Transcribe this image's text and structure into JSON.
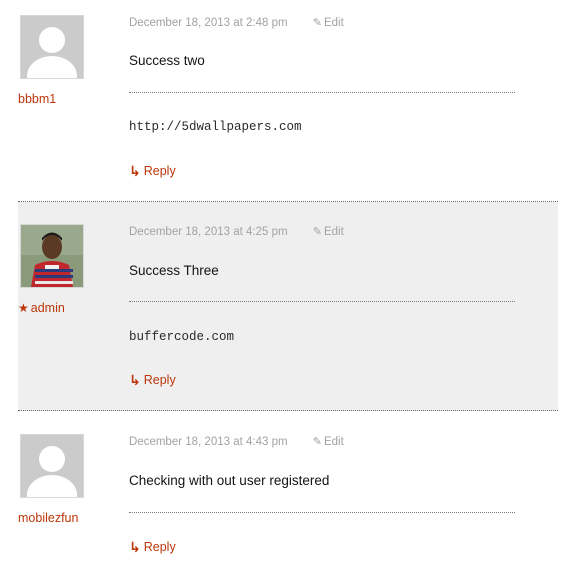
{
  "comments": [
    {
      "author": "bbbm1",
      "is_admin": false,
      "date": "December 18, 2013 at 2:48 pm",
      "edit_label": "Edit",
      "text": "Success two",
      "signature": "http://5dwallpapers.com",
      "reply_label": "Reply"
    },
    {
      "author": "admin",
      "is_admin": true,
      "date": "December 18, 2013 at 4:25 pm",
      "edit_label": "Edit",
      "text": "Success Three",
      "signature": "buffercode.com",
      "reply_label": "Reply"
    },
    {
      "author": "mobilezfun",
      "is_admin": false,
      "date": "December 18, 2013 at 4:43 pm",
      "edit_label": "Edit",
      "text": "Checking with out user registered",
      "signature": "",
      "reply_label": "Reply"
    }
  ],
  "icons": {
    "edit": "pencil-icon",
    "reply": "reply-arrow-icon",
    "admin_badge": "star-icon"
  },
  "colors": {
    "link": "#bc360a",
    "meta": "#a2a2a2",
    "admin_background": "#efefef"
  }
}
